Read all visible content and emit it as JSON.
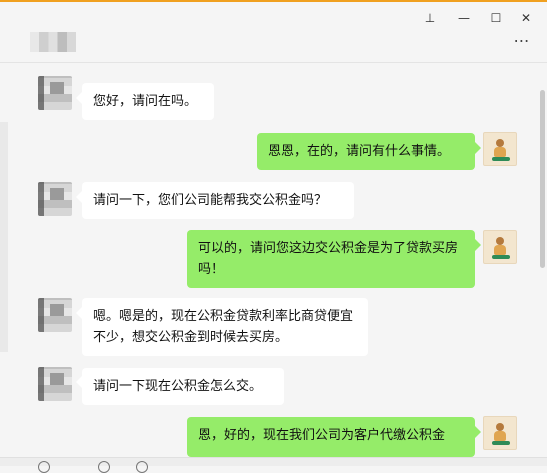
{
  "window": {
    "pin_icon": "pin-icon",
    "minimize_glyph": "—",
    "maximize_glyph": "☐",
    "close_glyph": "✕",
    "pin_glyph": "⊥"
  },
  "header": {
    "more_glyph": "⋯"
  },
  "messages": [
    {
      "side": "in",
      "text": "您好，请问在吗。"
    },
    {
      "side": "out",
      "text": "恩恩，在的，请问有什么事情。"
    },
    {
      "side": "in",
      "text": "请问一下，您们公司能帮我交公积金吗？"
    },
    {
      "side": "out",
      "text": "可以的，请问您这边交公积金是为了贷款买房吗！"
    },
    {
      "side": "in",
      "text": "嗯。嗯是的，现在公积金贷款利率比商贷便宜不少，想交公积金到时候去买房。"
    },
    {
      "side": "in",
      "text": "请问一下现在公积金怎么交。"
    },
    {
      "side": "out",
      "text": "恩，好的，现在我们公司为客户代缴公积金"
    }
  ],
  "colors": {
    "accent_top": "#f0a020",
    "bubble_out": "#95ec69",
    "bubble_in": "#ffffff",
    "background": "#f5f5f5"
  }
}
